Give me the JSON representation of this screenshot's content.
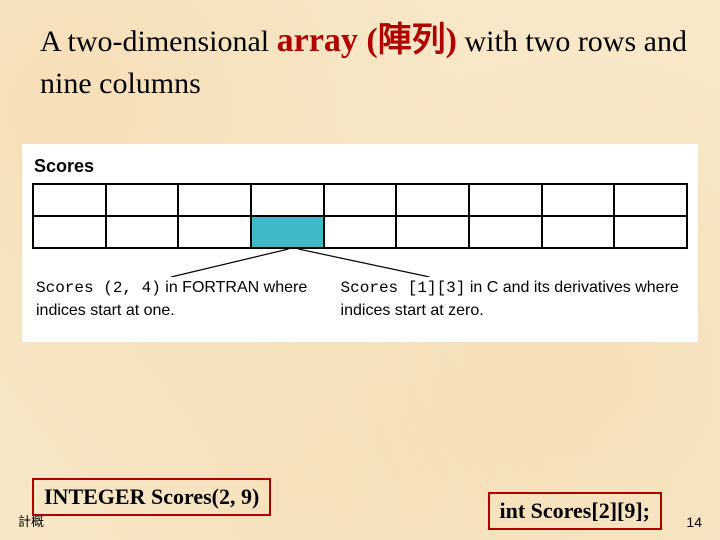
{
  "title": {
    "pre": "A two-dimensional ",
    "emph": "array (陣列)",
    "post": " with two rows and nine columns"
  },
  "figure": {
    "label": "Scores",
    "rows": 2,
    "cols": 9,
    "highlight": {
      "row": 1,
      "col": 3
    },
    "caption_left": {
      "code": "Scores (2, 4)",
      "rest": " in FORTRAN where indices start at one."
    },
    "caption_right": {
      "code": "Scores [1][3]",
      "rest": " in C and its derivatives where indices start at zero."
    }
  },
  "declarations": {
    "fortran": "INTEGER Scores(2, 9)",
    "c": "int Scores[2][9];"
  },
  "footer": {
    "left": "計概",
    "page": "14"
  }
}
